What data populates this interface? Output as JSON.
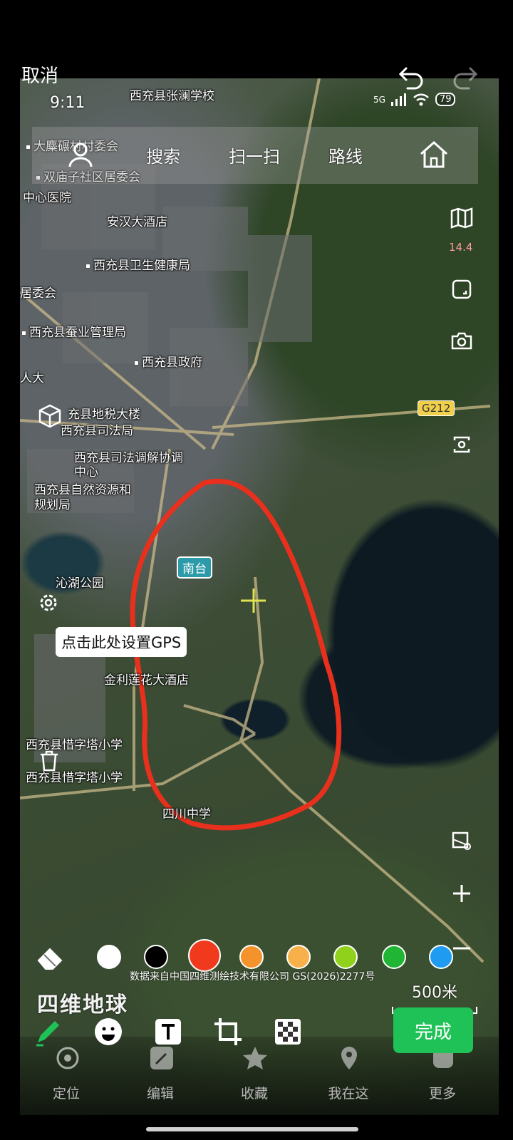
{
  "topbar": {
    "cancel_label": "取消"
  },
  "status": {
    "time": "9:11",
    "network": "5G",
    "battery": "79"
  },
  "search_bar": {
    "items": [
      "搜索",
      "扫一扫",
      "路线"
    ]
  },
  "map_tools": {
    "zoom_level": "14.4"
  },
  "map_labels": [
    "西充县张澜学校",
    "大麋碾村村委会",
    "双庙子社区居委会",
    "中心医院",
    "安汉大酒店",
    "西充县卫生健康局",
    "居委会",
    "西充县蚕业管理局",
    "西充县政府",
    "人大",
    "充县地税大楼",
    "西充县司法局",
    "西充县司法调解协调中心",
    "西充县自然资源和规划局",
    "沁湖公园",
    "金利莲花大酒店",
    "西充县惜字塔小学",
    "西充县惜字塔小学",
    "四川中学"
  ],
  "road_badge": "G212",
  "station_badge": "南台",
  "gps_tip": "点击此处设置GPS",
  "copyright": "数据来自中国四维测绘技术有限公司 GS(2026)2277号",
  "brand": "四维地球",
  "scale": "500米",
  "palette": {
    "colors": [
      "#ffffff",
      "#000000",
      "#f0391d",
      "#f4922b",
      "#f8b04a",
      "#8fd11b",
      "#20b534",
      "#1f9bf2"
    ],
    "selected": "#f0391d"
  },
  "done_button": "完成",
  "bottom_nav": {
    "items": [
      "定位",
      "编辑",
      "收藏",
      "我在这",
      "更多"
    ]
  }
}
